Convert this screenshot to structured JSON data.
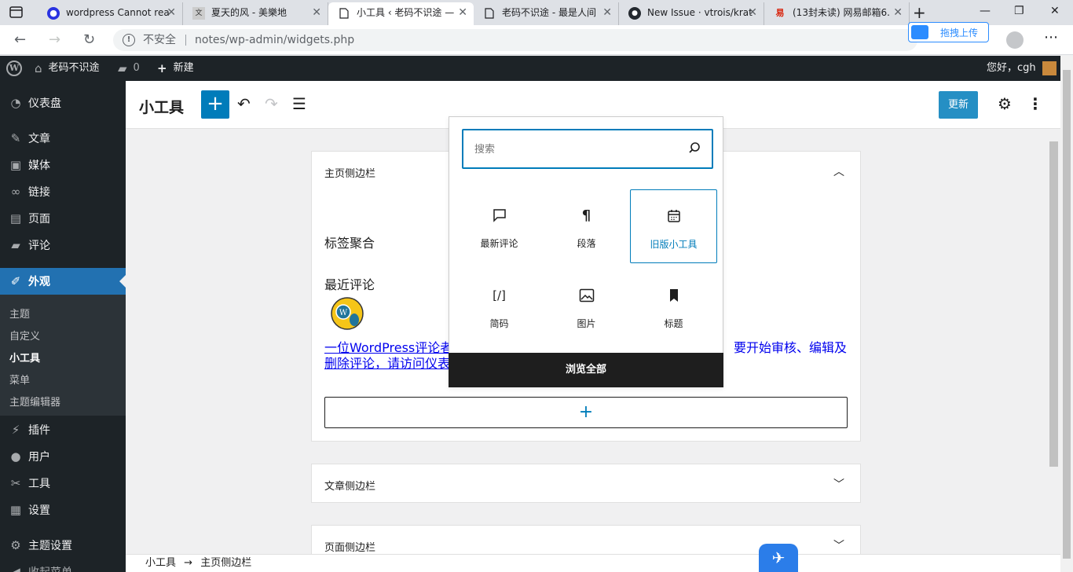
{
  "browser": {
    "tabs": [
      {
        "title": "wordpress Cannot rea",
        "favicon": "baidu-paw-icon"
      },
      {
        "title": "夏天的风 - 美樂地",
        "favicon": "site-icon"
      },
      {
        "title": "小工具 ‹ 老码不识途 —",
        "favicon": "page-icon",
        "active": true
      },
      {
        "title": "老码不识途 - 最是人间",
        "favicon": "page-icon"
      },
      {
        "title": "New Issue · vtrois/krat",
        "favicon": "github-icon"
      },
      {
        "title": "(13封未读) 网易邮箱6.",
        "favicon": "netease-icon"
      }
    ],
    "insecure_label": "不安全",
    "url": "notes/wp-admin/widgets.php",
    "upload_label": "拖拽上传"
  },
  "adminbar": {
    "site_name": "老码不识途",
    "comments_count": "0",
    "new_label": "新建",
    "greeting": "您好，cgh"
  },
  "sidebar": {
    "items": [
      {
        "label": "仪表盘",
        "icon": "dashboard-icon"
      },
      {
        "label": "文章",
        "icon": "pin-icon"
      },
      {
        "label": "媒体",
        "icon": "media-icon"
      },
      {
        "label": "链接",
        "icon": "link-icon"
      },
      {
        "label": "页面",
        "icon": "page-icon"
      },
      {
        "label": "评论",
        "icon": "comment-icon"
      },
      {
        "label": "外观",
        "icon": "brush-icon",
        "active": true
      },
      {
        "label": "插件",
        "icon": "plugin-icon"
      },
      {
        "label": "用户",
        "icon": "user-icon"
      },
      {
        "label": "工具",
        "icon": "wrench-icon"
      },
      {
        "label": "设置",
        "icon": "settings-icon"
      },
      {
        "label": "主题设置",
        "icon": "gear-icon"
      },
      {
        "label": "收起菜单",
        "icon": "collapse-icon"
      }
    ],
    "submenu": [
      {
        "label": "主题"
      },
      {
        "label": "自定义"
      },
      {
        "label": "小工具",
        "current": true
      },
      {
        "label": "菜单"
      },
      {
        "label": "主题编辑器"
      }
    ]
  },
  "editor": {
    "title": "小工具",
    "update_label": "更新"
  },
  "areas": {
    "main": {
      "title": "主页侧边栏",
      "widget_tags": "标签聚合",
      "widget_comments": "最近评论",
      "comment_link_left_1": "一位WordPress评论者",
      "comment_link_right_1": "要开始审核、编辑及",
      "comment_link_left_2": "删除评论，请访问仪表"
    },
    "posts": {
      "title": "文章侧边栏"
    },
    "pages": {
      "title": "页面侧边栏"
    }
  },
  "inserter": {
    "search_placeholder": "搜索",
    "blocks": [
      {
        "label": "最新评论",
        "icon": "comment-bubble-icon"
      },
      {
        "label": "段落",
        "icon": "paragraph-icon"
      },
      {
        "label": "旧版小工具",
        "icon": "calendar-icon",
        "selected": true
      },
      {
        "label": "简码",
        "icon": "shortcode-icon"
      },
      {
        "label": "图片",
        "icon": "image-icon"
      },
      {
        "label": "标题",
        "icon": "bookmark-icon"
      }
    ],
    "browse_all": "浏览全部"
  },
  "footer": {
    "breadcrumb_1": "小工具",
    "arrow": "→",
    "breadcrumb_2": "主页侧边栏"
  },
  "colors": {
    "wp_blue": "#007cba",
    "admin_dark": "#1d2327",
    "menu_active": "#2271b1"
  }
}
